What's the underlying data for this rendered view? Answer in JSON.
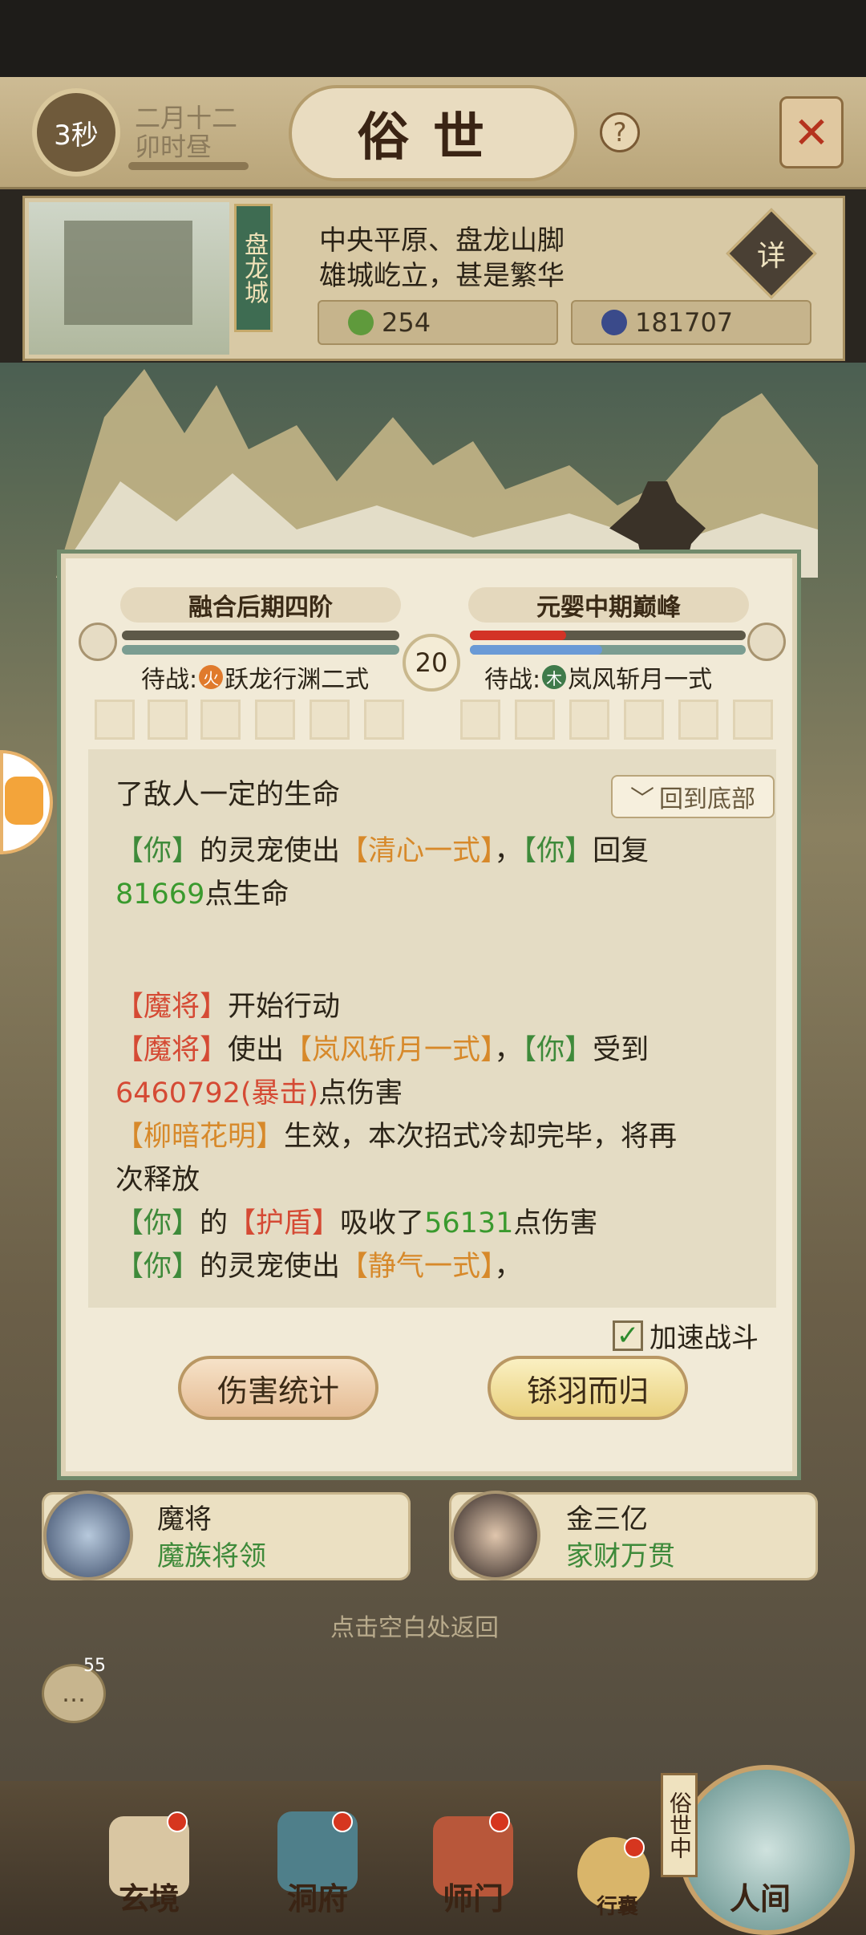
{
  "header": {
    "timer": "3秒",
    "date_line1": "二月十二",
    "date_line2": "卯时昼",
    "title": "俗世",
    "help_label": "?"
  },
  "location": {
    "city_name": "盘龙城",
    "desc_line1": "中央平原、盘龙山脚",
    "desc_line2": "雄城屹立，甚是繁华",
    "detail_label": "详",
    "jade": "254",
    "coins": "181707"
  },
  "battle": {
    "player_realm": "融合后期四阶",
    "enemy_realm": "元婴中期巅峰",
    "round": "20",
    "player_wait_prefix": "待战:",
    "player_wait_element": "火",
    "player_wait_skill": "跃龙行渊二式",
    "enemy_wait_prefix": "待战:",
    "enemy_wait_element": "木",
    "enemy_wait_skill": "岚风斩月一式",
    "enemy_hp_fraction": 0.35,
    "enemy_mp_fraction": 0.48,
    "back_to_bottom": "回到底部",
    "log": {
      "l1": "了敌人一定的生命",
      "l2_a": "【你】",
      "l2_b": "的灵宠使出",
      "l2_c": "【清心一式】",
      "l2_d": "，",
      "l2_e": "【你】",
      "l2_f": "回复",
      "l3_a": "81669",
      "l3_b": "点生命",
      "l4_a": "【魔将】",
      "l4_b": "开始行动",
      "l5_a": "【魔将】",
      "l5_b": "使出",
      "l5_c": "【岚风斩月一式】",
      "l5_d": "，",
      "l5_e": "【你】",
      "l5_f": "受到",
      "l6_a": "6460792(暴击)",
      "l6_b": "点伤害",
      "l7_a": "【柳暗花明】",
      "l7_b": "生效，本次招式冷却完毕，将再",
      "l8": "次释放",
      "l9_a": "【你】",
      "l9_b": "的",
      "l9_c": "【护盾】",
      "l9_d": "吸收了",
      "l9_e": "56131",
      "l9_f": "点伤害",
      "l10_a": "【你】",
      "l10_b": "的灵宠使出",
      "l10_c": "【静气一式】",
      "l10_d": "，"
    },
    "speed_label": "加速战斗",
    "speed_checked": true,
    "stats_button": "伤害统计",
    "retreat_button": "铩羽而归"
  },
  "npcs": [
    {
      "name": "魔将",
      "title": "魔族将领"
    },
    {
      "name": "金三亿",
      "title": "家财万贯"
    }
  ],
  "hint": "点击空白处返回",
  "chat_count": "55",
  "nav": {
    "items": [
      "玄境",
      "洞府",
      "师门",
      "行囊",
      "人间"
    ],
    "current_badge": "俗世中"
  },
  "colors": {
    "ally_green": "#3e8a3a",
    "skill_orange": "#d7892a",
    "enemy_red": "#d54a34",
    "hp_red": "#d33326",
    "mp_blue": "#6a9ad6"
  }
}
